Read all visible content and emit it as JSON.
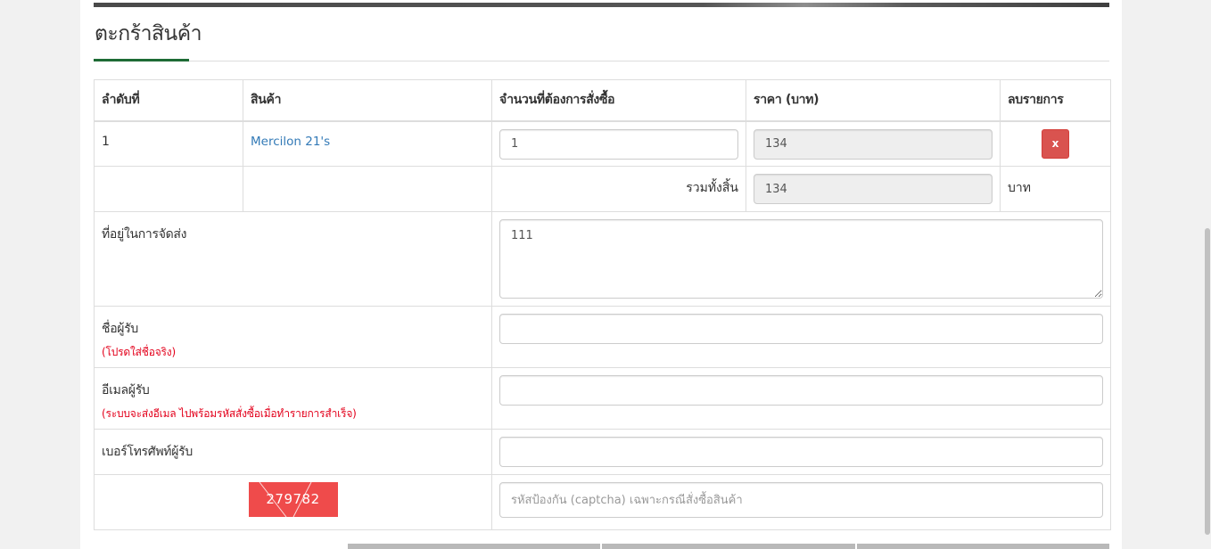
{
  "cart": {
    "title": "ตะกร้าสินค้า",
    "headers": {
      "index": "ลำดับที่",
      "product": "สินค้า",
      "quantity": "จำนวนที่ต้องการสั่งซื้อ",
      "price": "ราคา (บาท)",
      "remove": "ลบรายการ"
    },
    "items": [
      {
        "index": "1",
        "product": "Mercilon 21's",
        "quantity": "1",
        "price": "134",
        "remove_label": "x"
      }
    ],
    "total": {
      "label": "รวมทั้งสิ้น",
      "value": "134",
      "unit": "บาท"
    }
  },
  "form": {
    "address": {
      "label": "ที่อยู่ในการจัดส่ง",
      "value": "111"
    },
    "recipient_name": {
      "label": "ชื่อผู้รับ",
      "hint": "(โปรดใส่ชื่อจริง)",
      "value": ""
    },
    "recipient_email": {
      "label": "อีเมลผู้รับ",
      "hint": "(ระบบจะส่งอีเมล ไปพร้อมรหัสสั่งซื้อเมื่อทำรายการสำเร็จ)",
      "value": ""
    },
    "recipient_phone": {
      "label": "เบอร์โทรศัพท์ผู้รับ",
      "value": ""
    },
    "captcha": {
      "code": "279782",
      "placeholder": "รหัสป้องกัน (captcha) เฉพาะกรณีสั่งซื้อสินค้า"
    }
  },
  "colors": {
    "accent_green": "#1e6b35",
    "link_blue": "#337ab7",
    "danger_red": "#d9534f",
    "hint_red": "#e3001b",
    "captcha_bg": "#ef4b4b"
  }
}
